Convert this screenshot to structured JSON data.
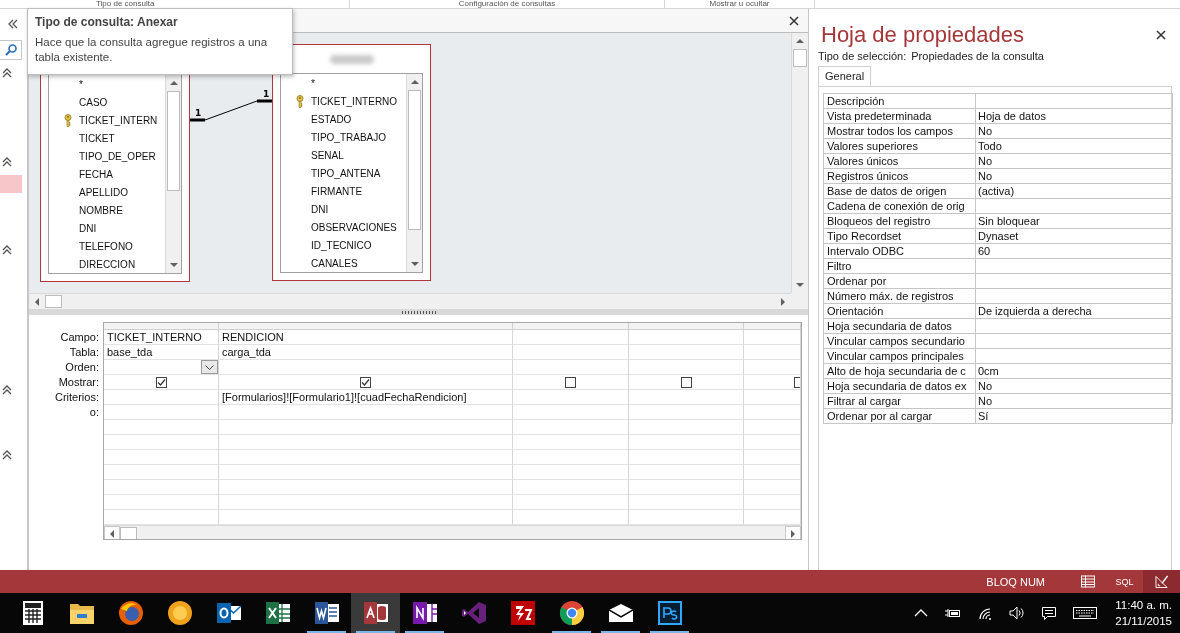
{
  "ribbon_groups": [
    {
      "label": "Tipo de consulta"
    },
    {
      "label": "Configuración de consultas"
    },
    {
      "label": "Mostrar u ocultar"
    }
  ],
  "tooltip": {
    "title": "Tipo de consulta: Anexar",
    "text": "Hace que la consulta agregue registros a una tabla existente."
  },
  "query_design": {
    "tables": [
      {
        "fields": [
          {
            "name": "*",
            "key": false
          },
          {
            "name": "CASO",
            "key": false
          },
          {
            "name": "TICKET_INTERN",
            "key": true
          },
          {
            "name": "TICKET",
            "key": false
          },
          {
            "name": "TIPO_DE_OPER",
            "key": false
          },
          {
            "name": "FECHA",
            "key": false
          },
          {
            "name": "APELLIDO",
            "key": false
          },
          {
            "name": "NOMBRE",
            "key": false
          },
          {
            "name": "DNI",
            "key": false
          },
          {
            "name": "TELEFONO",
            "key": false
          },
          {
            "name": "DIRECCION",
            "key": false
          }
        ]
      },
      {
        "title_blurred": true,
        "fields": [
          {
            "name": "*",
            "key": false
          },
          {
            "name": "TICKET_INTERNO",
            "key": true
          },
          {
            "name": "ESTADO",
            "key": false
          },
          {
            "name": "TIPO_TRABAJO",
            "key": false
          },
          {
            "name": "SENAL",
            "key": false
          },
          {
            "name": "TIPO_ANTENA",
            "key": false
          },
          {
            "name": "FIRMANTE",
            "key": false
          },
          {
            "name": "DNI",
            "key": false
          },
          {
            "name": "OBSERVACIONES",
            "key": false
          },
          {
            "name": "ID_TECNICO",
            "key": false
          },
          {
            "name": "CANALES",
            "key": false
          }
        ]
      }
    ],
    "relationship": {
      "left_label": "1",
      "right_label": "1"
    }
  },
  "design_grid": {
    "row_labels": [
      "Campo:",
      "Tabla:",
      "Orden:",
      "Mostrar:",
      "Criterios:",
      "o:"
    ],
    "columns": [
      {
        "field": "TICKET_INTERNO",
        "table": "base_tda",
        "checked": true,
        "active": true
      },
      {
        "field": "RENDICION",
        "table": "carga_tda",
        "checked": true,
        "criteria": "[Formularios]![Formulario1]![cuadFechaRendicion]",
        "active": false
      },
      {
        "checked": false,
        "active": false
      },
      {
        "checked": false,
        "active": false
      },
      {
        "checked": false,
        "active": false
      }
    ]
  },
  "property_sheet": {
    "title": "Hoja de propiedades",
    "selection_label": "Tipo de selección:",
    "selection_value": "Propiedades de la consulta",
    "tabs": [
      {
        "label": "General",
        "selected": true
      }
    ],
    "properties": [
      {
        "label": "Descripción"
      },
      {
        "label": "Vista predeterminada",
        "value": "Hoja de datos"
      },
      {
        "label": "Mostrar todos los campos",
        "value": "No"
      },
      {
        "label": "Valores superiores",
        "value": "Todo"
      },
      {
        "label": "Valores únicos",
        "value": "No"
      },
      {
        "label": "Registros únicos",
        "value": "No"
      },
      {
        "label": "Base de datos de origen",
        "value": "(activa)"
      },
      {
        "label": "Cadena de conexión de orig"
      },
      {
        "label": "Bloqueos del registro",
        "value": "Sin bloquear"
      },
      {
        "label": "Tipo Recordset",
        "value": "Dynaset"
      },
      {
        "label": "Intervalo ODBC",
        "value": "60"
      },
      {
        "label": "Filtro"
      },
      {
        "label": "Ordenar por"
      },
      {
        "label": "Número máx. de registros"
      },
      {
        "label": "Orientación",
        "value": "De izquierda a derecha"
      },
      {
        "label": "Hoja secundaria de datos"
      },
      {
        "label": "Vincular campos secundario"
      },
      {
        "label": "Vincular campos principales"
      },
      {
        "label": "Alto de hoja secundaria de c",
        "value": "0cm"
      },
      {
        "label": "Hoja secundaria de datos ex",
        "value": "No"
      },
      {
        "label": "Filtrar al cargar",
        "value": "No"
      },
      {
        "label": "Ordenar por al cargar",
        "value": "Sí"
      }
    ]
  },
  "status_bar": {
    "indicator": "BLOQ NUM",
    "views": [
      {
        "kind": "datasheet",
        "selected": false
      },
      {
        "kind": "sql",
        "label": "SQL",
        "selected": false
      },
      {
        "kind": "design",
        "selected": true
      }
    ]
  },
  "taskbar": {
    "apps": [
      {
        "kind": "calculator",
        "running": false,
        "active": false
      },
      {
        "kind": "folder",
        "running": false,
        "active": false
      },
      {
        "kind": "globe",
        "running": false,
        "active": false
      },
      {
        "kind": "ring",
        "running": false,
        "active": false
      },
      {
        "kind": "mail_tile",
        "running": false,
        "active": false
      },
      {
        "kind": "spreadsheet",
        "running": false,
        "active": false
      },
      {
        "kind": "document",
        "running": true,
        "active": false
      },
      {
        "kind": "database",
        "running": true,
        "active": true
      },
      {
        "kind": "notebook",
        "running": true,
        "active": false
      },
      {
        "kind": "knot",
        "running": false,
        "active": false
      },
      {
        "kind": "bolt",
        "running": false,
        "active": false
      },
      {
        "kind": "browser",
        "running": true,
        "active": false
      },
      {
        "kind": "envelope",
        "running": true,
        "active": false
      },
      {
        "kind": "framed",
        "running": true,
        "active": false
      }
    ],
    "time": "11:40 a. m.",
    "date": "21/11/2015"
  }
}
